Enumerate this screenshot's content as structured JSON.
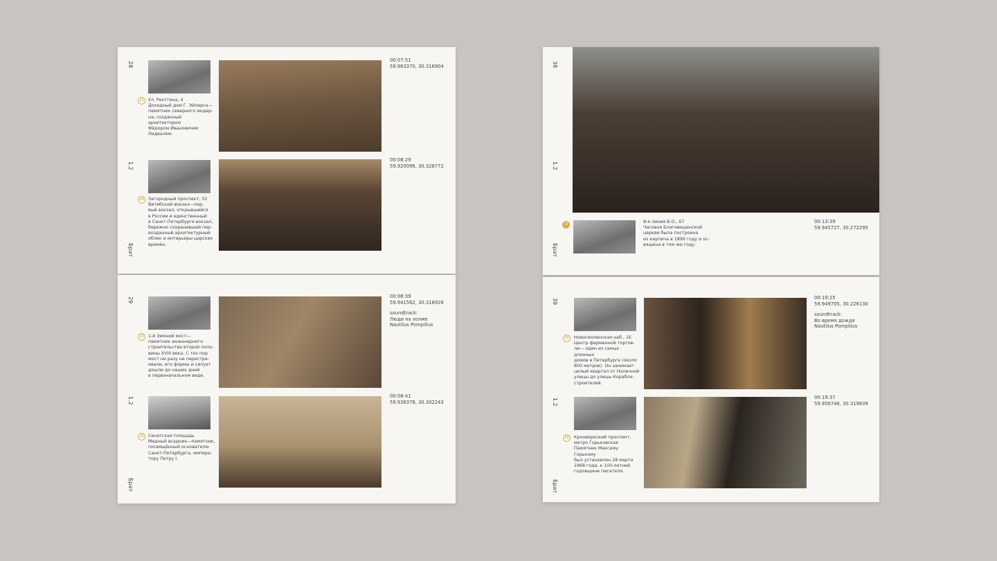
{
  "book_title": "Брат",
  "section": "1.2",
  "pages": [
    {
      "number": "28",
      "entries": [
        {
          "badge": "23",
          "address": "Ул. Рентгена, 4",
          "text": [
            "Доходный дом Г. Эйлерса—",
            "памятник северного модер-",
            "на, созданный архитектором",
            "Фёдором Ивановичем",
            "Лидвалем."
          ],
          "time": "00:07:51",
          "coords": "59.963370, 30.316904"
        },
        {
          "badge": "24",
          "address": "Загородный проспект, 52",
          "text": [
            "Витебский вокзал—пер-",
            "вый вокзал, открывшийся",
            "в России и единственный",
            "в Санкт-Петербурге вокзал,",
            "бережно сохранивший пер-",
            "возданный архитектурный",
            "облик и интерьеры царских",
            "времён."
          ],
          "time": "00:08:29",
          "coords": "59.920096, 30.328772"
        }
      ]
    },
    {
      "number": "29",
      "entries": [
        {
          "badge": "25",
          "address": "1-й Зимний мост—",
          "text": [
            "памятник инженерного",
            "строительства второй поло-",
            "вины XVIII века. С тех пор",
            "мост ни разу не перестра-",
            "ивали, его формы и силуэт",
            "дошли до наших дней",
            "в первоначальном виде."
          ],
          "time": "00:08:39",
          "coords": "59.941562, 30.318928",
          "soundtrack_label": "soundtrack:",
          "song": "Люди на холме",
          "artist": "Nautilus Pompilius"
        },
        {
          "badge": "26",
          "address": "Сенатская площадь",
          "text": [
            "Медный всадник—памятник,",
            "посвящённый основателю",
            "Санкт-Петербурга, импера-",
            "тору Петру I."
          ],
          "time": "00:08:41",
          "coords": "59.936378, 30.302243"
        }
      ]
    },
    {
      "number": "38",
      "entries": [
        {
          "badge": "15",
          "address": "8-я линия В.О., 67",
          "text": [
            "Часовня Благовещенской",
            "церкви была построена",
            "из кирпича в 1899 году и ос-",
            "вящена в том же году."
          ],
          "time": "00:13:39",
          "coords": "59.945727, 30.272295"
        }
      ]
    },
    {
      "number": "39",
      "entries": [
        {
          "badge": "35",
          "address": "Новосмоленская наб., 1Е",
          "text": [
            "Центр фирменной торгов-",
            "ли— один из самых длинных",
            "домов в Петербурге (около",
            "800 метров). Он занимает",
            "целый квартал от Наличной",
            "улицы до улицы Корабле-",
            "строителей."
          ],
          "time": "00:19:25",
          "coords": "59.949705, 30.226130",
          "soundtrack_label": "soundtrack:",
          "song": "Во время дождя",
          "artist": "Nautilus Pompilius"
        },
        {
          "badge": "36",
          "address": "Кронверкский проспект,",
          "text": [
            "метро Горьковская",
            "Памятник Максиму Горькому",
            "был установлен 28 марта",
            "1968 года, к 100-летней",
            "годовщине писателя."
          ],
          "time": "00:19:37",
          "coords": "59.956746, 30.319839"
        }
      ]
    }
  ],
  "colors": {
    "accent": "#d4ad3f",
    "background": "#c8c5c0",
    "paper": "#f7f6f3"
  }
}
